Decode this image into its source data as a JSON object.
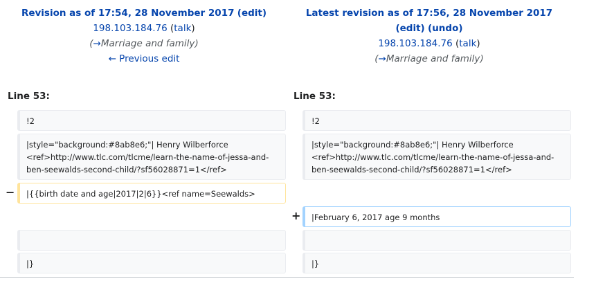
{
  "left_header": {
    "title_prefix": "Revision as of 17:54, 28 November 2017",
    "edit_label": "edit",
    "user": "198.103.184.76",
    "talk_label": "talk",
    "comment_arrow": "→",
    "comment": "Marriage and family",
    "previous_edit": "← Previous edit"
  },
  "right_header": {
    "title_prefix": "Latest revision as of 17:56, 28 November 2017",
    "edit_label": "edit",
    "undo_label": "undo",
    "user": "198.103.184.76",
    "talk_label": "talk",
    "comment_arrow": "→",
    "comment": "Marriage and family"
  },
  "line_label_left": "Line 53:",
  "line_label_right": "Line 53:",
  "left_cells": {
    "c1": "!2",
    "c2": "|style=\"background:#8ab8e6;\"| Henry Wilberforce <ref>http://www.tlc.com/tlcme/learn-the-name-of-jessa-and-ben-seewalds-second-child/?sf56028871=1</ref>",
    "deleted": "|{{birth date and age|2017|2|6}}<ref name=Seewalds>",
    "c4": "",
    "c5": "|}"
  },
  "right_cells": {
    "c1": "!2",
    "c2": "|style=\"background:#8ab8e6;\"| Henry Wilberforce <ref>http://www.tlc.com/tlcme/learn-the-name-of-jessa-and-ben-seewalds-second-child/?sf56028871=1</ref>",
    "added": "|February 6, 2017 age 9 months",
    "c4": "",
    "c5": "|}"
  },
  "markers": {
    "minus": "−",
    "plus": "+"
  }
}
